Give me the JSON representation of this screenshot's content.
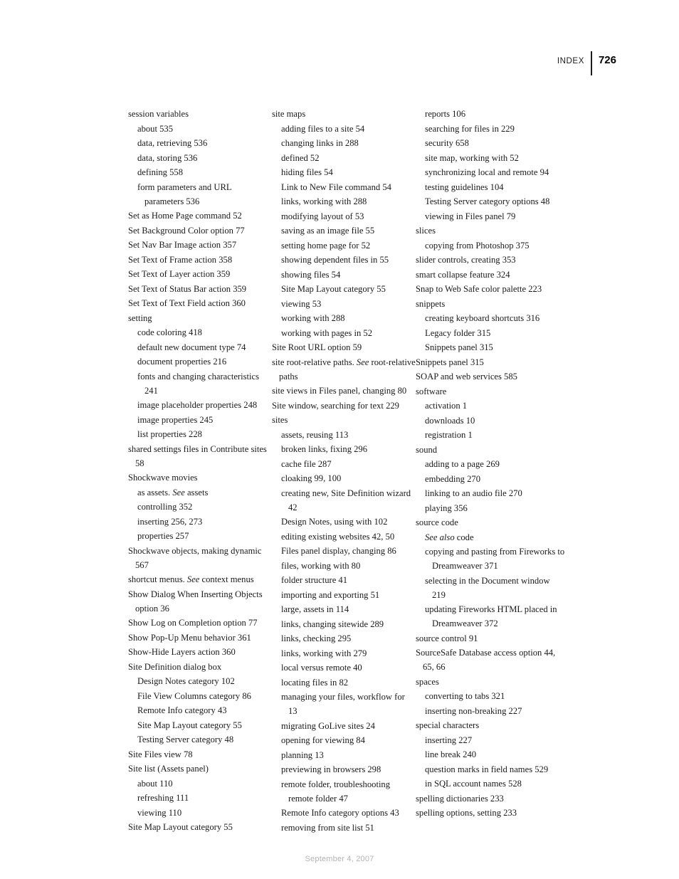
{
  "header": {
    "label": "INDEX",
    "page_number": "726"
  },
  "footer": {
    "date": "September 4, 2007"
  },
  "colors": {
    "text": "#1a1a1a",
    "footer_text": "#b3b3b3",
    "rule": "#1a1a1a"
  },
  "columns": [
    {
      "entries": [
        {
          "level": 0,
          "text": "session variables"
        },
        {
          "level": 1,
          "text": "about 535"
        },
        {
          "level": 1,
          "text": "data, retrieving 536"
        },
        {
          "level": 1,
          "text": "data, storing 536"
        },
        {
          "level": 1,
          "text": "defining 558"
        },
        {
          "level": 1,
          "text": "form parameters and URL parameters 536"
        },
        {
          "level": 0,
          "text": "Set as Home Page command 52"
        },
        {
          "level": 0,
          "text": "Set Background Color option 77"
        },
        {
          "level": 0,
          "text": "Set Nav Bar Image action 357"
        },
        {
          "level": 0,
          "text": "Set Text of Frame action 358"
        },
        {
          "level": 0,
          "text": "Set Text of Layer action 359"
        },
        {
          "level": 0,
          "text": "Set Text of Status Bar action 359"
        },
        {
          "level": 0,
          "text": "Set Text of Text Field action 360"
        },
        {
          "level": 0,
          "text": "setting"
        },
        {
          "level": 1,
          "text": "code coloring 418"
        },
        {
          "level": 1,
          "text": "default new document type 74"
        },
        {
          "level": 1,
          "text": "document properties 216"
        },
        {
          "level": 1,
          "text": "fonts and changing characteristics 241"
        },
        {
          "level": 1,
          "text": "image placeholder properties 248"
        },
        {
          "level": 1,
          "text": "image properties 245"
        },
        {
          "level": 1,
          "text": "list properties 228"
        },
        {
          "level": 0,
          "text": "shared settings files in Contribute sites 58"
        },
        {
          "level": 0,
          "text": "Shockwave movies"
        },
        {
          "level": 1,
          "text": "as assets. ",
          "italic": "See",
          "text_after": " assets"
        },
        {
          "level": 1,
          "text": "controlling 352"
        },
        {
          "level": 1,
          "text": "inserting 256, 273"
        },
        {
          "level": 1,
          "text": "properties 257"
        },
        {
          "level": 0,
          "text": "Shockwave objects, making dynamic 567"
        },
        {
          "level": 0,
          "text": "shortcut menus. ",
          "italic": "See",
          "text_after": " context menus"
        },
        {
          "level": 0,
          "text": "Show Dialog When Inserting Objects option 36"
        },
        {
          "level": 0,
          "text": "Show Log on Completion option 77"
        },
        {
          "level": 0,
          "text": "Show Pop-Up Menu behavior 361"
        },
        {
          "level": 0,
          "text": "Show-Hide Layers action 360"
        },
        {
          "level": 0,
          "text": "Site Definition dialog box"
        },
        {
          "level": 1,
          "text": "Design Notes category 102"
        },
        {
          "level": 1,
          "text": "File View Columns category 86"
        },
        {
          "level": 1,
          "text": "Remote Info category 43"
        },
        {
          "level": 1,
          "text": "Site Map Layout category 55"
        },
        {
          "level": 1,
          "text": "Testing Server category 48"
        },
        {
          "level": 0,
          "text": "Site Files view 78"
        },
        {
          "level": 0,
          "text": "Site list (Assets panel)"
        },
        {
          "level": 1,
          "text": "about 110"
        },
        {
          "level": 1,
          "text": "refreshing 111"
        },
        {
          "level": 1,
          "text": "viewing 110"
        },
        {
          "level": 0,
          "text": "Site Map Layout category 55"
        }
      ]
    },
    {
      "entries": [
        {
          "level": 0,
          "text": "site maps"
        },
        {
          "level": 1,
          "text": "adding files to a site 54"
        },
        {
          "level": 1,
          "text": "changing links in 288"
        },
        {
          "level": 1,
          "text": "defined 52"
        },
        {
          "level": 1,
          "text": "hiding files 54"
        },
        {
          "level": 1,
          "text": "Link to New File command 54"
        },
        {
          "level": 1,
          "text": "links, working with 288"
        },
        {
          "level": 1,
          "text": "modifying layout of 53"
        },
        {
          "level": 1,
          "text": "saving as an image file 55"
        },
        {
          "level": 1,
          "text": "setting home page for 52"
        },
        {
          "level": 1,
          "text": "showing dependent files in 55"
        },
        {
          "level": 1,
          "text": "showing files 54"
        },
        {
          "level": 1,
          "text": "Site Map Layout category 55"
        },
        {
          "level": 1,
          "text": "viewing 53"
        },
        {
          "level": 1,
          "text": "working with 288"
        },
        {
          "level": 1,
          "text": "working with pages in 52"
        },
        {
          "level": 0,
          "text": "Site Root URL option 59"
        },
        {
          "level": 0,
          "text": "site root-relative paths. ",
          "italic": "See",
          "text_after": " root-relative paths"
        },
        {
          "level": 0,
          "text": "site views in Files panel, changing 80"
        },
        {
          "level": 0,
          "text": "Site window, searching for text 229"
        },
        {
          "level": 0,
          "text": "sites"
        },
        {
          "level": 1,
          "text": "assets, reusing 113"
        },
        {
          "level": 1,
          "text": "broken links, fixing 296"
        },
        {
          "level": 1,
          "text": "cache file 287"
        },
        {
          "level": 1,
          "text": "cloaking 99, 100"
        },
        {
          "level": 1,
          "text": "creating new, Site Definition wizard 42"
        },
        {
          "level": 1,
          "text": "Design Notes, using with 102"
        },
        {
          "level": 1,
          "text": "editing existing websites 42, 50"
        },
        {
          "level": 1,
          "text": "Files panel display, changing 86"
        },
        {
          "level": 1,
          "text": "files, working with 80"
        },
        {
          "level": 1,
          "text": "folder structure 41"
        },
        {
          "level": 1,
          "text": "importing and exporting 51"
        },
        {
          "level": 1,
          "text": "large, assets in 114"
        },
        {
          "level": 1,
          "text": "links, changing sitewide 289"
        },
        {
          "level": 1,
          "text": "links, checking 295"
        },
        {
          "level": 1,
          "text": "links, working with 279"
        },
        {
          "level": 1,
          "text": "local versus remote 40"
        },
        {
          "level": 1,
          "text": "locating files in 82"
        },
        {
          "level": 1,
          "text": "managing your files, workflow for 13"
        },
        {
          "level": 1,
          "text": "migrating GoLive sites 24"
        },
        {
          "level": 1,
          "text": "opening for viewing 84"
        },
        {
          "level": 1,
          "text": "planning 13"
        },
        {
          "level": 1,
          "text": "previewing in browsers 298"
        },
        {
          "level": 1,
          "text": "remote folder, troubleshooting remote folder 47"
        },
        {
          "level": 1,
          "text": "Remote Info category options 43"
        },
        {
          "level": 1,
          "text": "removing from site list 51"
        }
      ]
    },
    {
      "entries": [
        {
          "level": 1,
          "text": "reports 106"
        },
        {
          "level": 1,
          "text": "searching for files in 229"
        },
        {
          "level": 1,
          "text": "security 658"
        },
        {
          "level": 1,
          "text": "site map, working with 52"
        },
        {
          "level": 1,
          "text": "synchronizing local and remote 94"
        },
        {
          "level": 1,
          "text": "testing guidelines 104"
        },
        {
          "level": 1,
          "text": "Testing Server category options 48"
        },
        {
          "level": 1,
          "text": "viewing in Files panel 79"
        },
        {
          "level": 0,
          "text": "slices"
        },
        {
          "level": 1,
          "text": "copying from Photoshop 375"
        },
        {
          "level": 0,
          "text": "slider controls, creating 353"
        },
        {
          "level": 0,
          "text": "smart collapse feature 324"
        },
        {
          "level": 0,
          "text": "Snap to Web Safe color palette 223"
        },
        {
          "level": 0,
          "text": "snippets"
        },
        {
          "level": 1,
          "text": "creating keyboard shortcuts 316"
        },
        {
          "level": 1,
          "text": "Legacy folder 315"
        },
        {
          "level": 1,
          "text": "Snippets panel 315"
        },
        {
          "level": 0,
          "text": "Snippets panel 315"
        },
        {
          "level": 0,
          "text": "SOAP and web services 585"
        },
        {
          "level": 0,
          "text": "software"
        },
        {
          "level": 1,
          "text": "activation 1"
        },
        {
          "level": 1,
          "text": "downloads 10"
        },
        {
          "level": 1,
          "text": "registration 1"
        },
        {
          "level": 0,
          "text": "sound"
        },
        {
          "level": 1,
          "text": "adding to a page 269"
        },
        {
          "level": 1,
          "text": "embedding 270"
        },
        {
          "level": 1,
          "text": "linking to an audio file 270"
        },
        {
          "level": 1,
          "text": "playing 356"
        },
        {
          "level": 0,
          "text": "source code"
        },
        {
          "level": 1,
          "text": "",
          "italic": "See also",
          "text_after": " code"
        },
        {
          "level": 1,
          "text": "copying and pasting from Fireworks to Dreamweaver 371"
        },
        {
          "level": 1,
          "text": "selecting in the Document window 219"
        },
        {
          "level": 1,
          "text": "updating Fireworks HTML placed in Dreamweaver 372"
        },
        {
          "level": 0,
          "text": "source control 91"
        },
        {
          "level": 0,
          "text": "SourceSafe Database access option 44, 65, 66"
        },
        {
          "level": 0,
          "text": "spaces"
        },
        {
          "level": 1,
          "text": "converting to tabs 321"
        },
        {
          "level": 1,
          "text": "inserting non-breaking 227"
        },
        {
          "level": 0,
          "text": "special characters"
        },
        {
          "level": 1,
          "text": "inserting 227"
        },
        {
          "level": 1,
          "text": "line break 240"
        },
        {
          "level": 1,
          "text": "question marks in field names 529"
        },
        {
          "level": 1,
          "text": "in SQL account names 528"
        },
        {
          "level": 0,
          "text": "spelling dictionaries 233"
        },
        {
          "level": 0,
          "text": "spelling options, setting 233"
        }
      ]
    }
  ]
}
